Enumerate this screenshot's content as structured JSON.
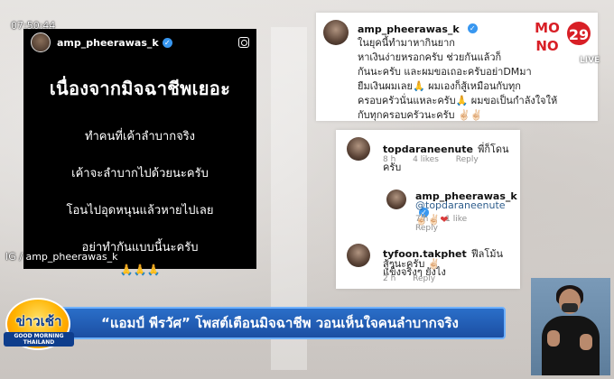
{
  "timestamp": "07:50:44",
  "ig_post": {
    "username": "amp_pheerawas_k",
    "title": "เนื่องจากมิจฉาชีพเยอะ",
    "lines": [
      "ทำคนที่เค้าลำบากจริง",
      "เค้าจะลำบากไปด้วยนะครับ",
      "โอนไปอุดหนุนแล้วหายไปเลย",
      "อย่าทำกันแบบนี้นะครับ"
    ],
    "emoji": "🙏🙏🙏",
    "credit": "IG / amp_pheerawas_k"
  },
  "top_card": {
    "username": "amp_pheerawas_k",
    "lines": [
      "ในยุคนี้ทำมาหากินยาก",
      "หาเงินง่ายหรอกครับ ช่วยกันแล้วก็",
      "กันนะครับ และผมขอเถอะครับอย่าDMมา",
      "ยืมเงินผมเลย🙏 ผมเองก็สู้เหมือนกับทุก",
      "ครอบครัวนั่นแหละครับ🙏 ผมขอเป็นกำลังใจให้",
      "กับทุกครอบครัวนะครับ ✌🏻✌🏻"
    ]
  },
  "comments": [
    {
      "username": "topdaraneenute",
      "text": "พี่ก็โดนครับ",
      "time": "8 h",
      "likes": "4 likes",
      "reply": "Reply"
    },
    {
      "username": "amp_pheerawas_k",
      "mention": "@topdaraneenute",
      "emoji": "✌🏻✌🏻",
      "heart": "❤",
      "time": "7 h",
      "likes": "1 like",
      "reply": "Reply"
    },
    {
      "username": "tyfoon.takphet",
      "text_line1": "ฟีลโม้นแข็งจริงๆ ยังไง",
      "text_line2": "สู้ๆนะครับ ✌🏻",
      "time": "2 h",
      "reply": "Reply"
    }
  ],
  "tv_logo": {
    "mo": "MO",
    "no": "NO",
    "number": "29",
    "live": "LIVE"
  },
  "lower_third": {
    "headline": "“แอมป์ พีรวัศ” โพสต์เตือนมิจฉาชีพ วอนเห็นใจคนลำบากจริง",
    "show_name": "ข่าวเช้า",
    "show_sub": "GOOD MORNING THAILAND"
  },
  "colors": {
    "accent_blue": "#1c4fa2",
    "brand_red": "#d81f26",
    "verified_blue": "#3897f0"
  }
}
